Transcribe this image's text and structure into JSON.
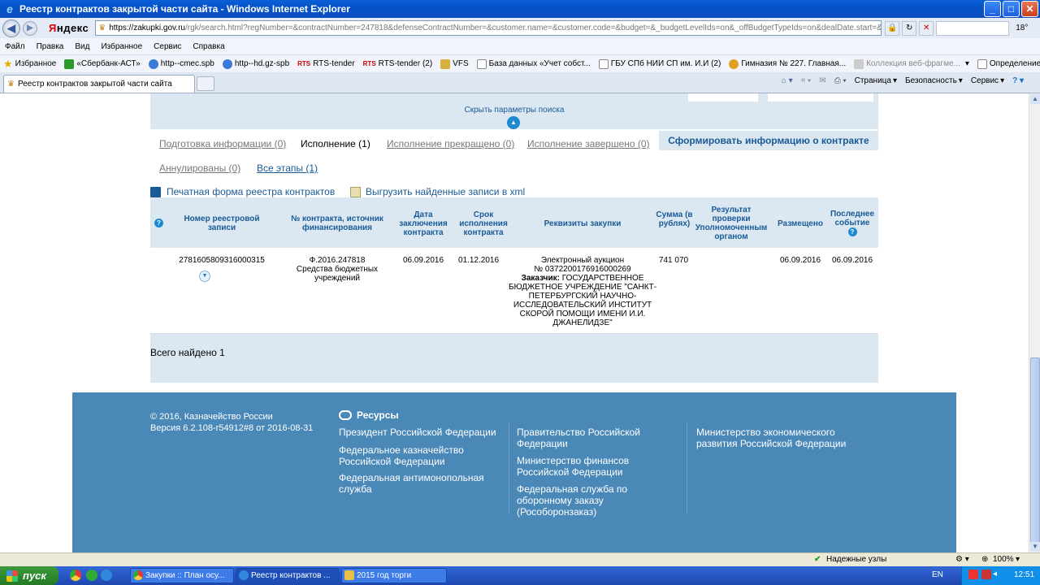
{
  "window": {
    "title": "Реестр контрактов закрытой части сайта - Windows Internet Explorer"
  },
  "address": {
    "host": "https://zakupki.gov.ru",
    "path": "/rgk/search.html?regNumber=&contractNumber=247818&defenseContractNumber=&customer.name=&customer.code=&budget=&_budgetLevelIds=on&_offBudgetTypeIds=on&dealDate.start=&dealDate.end=&registr",
    "yandex": "Яндекс",
    "weather": "18°"
  },
  "menu": [
    "Файл",
    "Правка",
    "Вид",
    "Избранное",
    "Сервис",
    "Справка"
  ],
  "favorites": {
    "label": "Избранное",
    "items": [
      "«Сбербанк-АСТ»",
      "http--cmec.spb",
      "http--hd.gz-spb",
      "RTS-tender",
      "RTS-tender (2)",
      "VFS",
      "База данных «Учет собст...",
      "ГБУ СПб НИИ СП им. И.И (2)",
      "Гимназия № 227. Главная...",
      "Коллекция веб-фрагме...",
      "Определение поставщика"
    ]
  },
  "tab": {
    "label": "Реестр контрактов закрытой части сайта"
  },
  "cmdbar": [
    "Страница",
    "Безопасность",
    "Сервис"
  ],
  "search": {
    "hide_label": "Скрыть параметры поиска"
  },
  "status_tabs": {
    "prep": "Подготовка информации (0)",
    "exec": "Исполнение (1)",
    "stopped": "Исполнение прекращено (0)",
    "done": "Исполнение завершено (0)",
    "cancelled": "Аннулированы (0)",
    "all": "Все этапы (1)",
    "generate": "Сформировать информацию о контракте"
  },
  "links": {
    "print": "Печатная форма реестра контрактов",
    "xml": "Выгрузить найденные записи в xml"
  },
  "table": {
    "headers": {
      "reg_no": "Номер реестровой записи",
      "contract": "№ контракта, источник финансирования",
      "date": "Дата заключения контракта",
      "term": "Срок исполнения контракта",
      "req": "Реквизиты закупки",
      "sum": "Сумма (в рублях)",
      "check": "Результат проверки Уполномоченным органом",
      "placed": "Размещено",
      "last": "Последнее событие"
    },
    "row": {
      "reg_no": "2781605809316000315",
      "contract_no": "Ф.2016.247818",
      "source": "Средства бюджетных учреждений",
      "date": "06.09.2016",
      "term": "01.12.2016",
      "req_type": "Электронный аукцион",
      "req_no": "№ 0372200176916000269",
      "customer_label": "Заказчик:",
      "customer": "ГОСУДАРСТВЕННОЕ БЮДЖЕТНОЕ УЧРЕЖДЕНИЕ \"САНКТ-ПЕТЕРБУРГСКИЙ НАУЧНО-ИССЛЕДОВАТЕЛЬСКИЙ ИНСТИТУТ СКОРОЙ ПОМОЩИ ИМЕНИ И.И. ДЖАНЕЛИДЗЕ\"",
      "sum": "741 070",
      "placed": "06.09.2016",
      "last": "06.09.2016"
    }
  },
  "total": "Всего найдено 1",
  "footer": {
    "copyright": "© 2016, Казначейство России",
    "version": "Версия 6.2.108-r54912#8 от 2016-08-31",
    "resources": "Ресурсы",
    "links": [
      "Президент Российской Федерации",
      "Федеральное казначейство Российской Федерации",
      "Федеральная антимонопольная служба",
      "Правительство Российской Федерации",
      "Министерство финансов Российской Федерации",
      "Федеральная служба по оборонному заказу (Рособоронзаказ)",
      "Министерство экономического развития Российской Федерации"
    ]
  },
  "statusbar": {
    "zone": "Надежные узлы",
    "zoom": "100%"
  },
  "taskbar": {
    "start": "пуск",
    "tasks": [
      "Закупки :: План осу...",
      "Реестр контрактов ...",
      "2015 год торги"
    ],
    "lang": "EN",
    "clock": "12:51"
  }
}
